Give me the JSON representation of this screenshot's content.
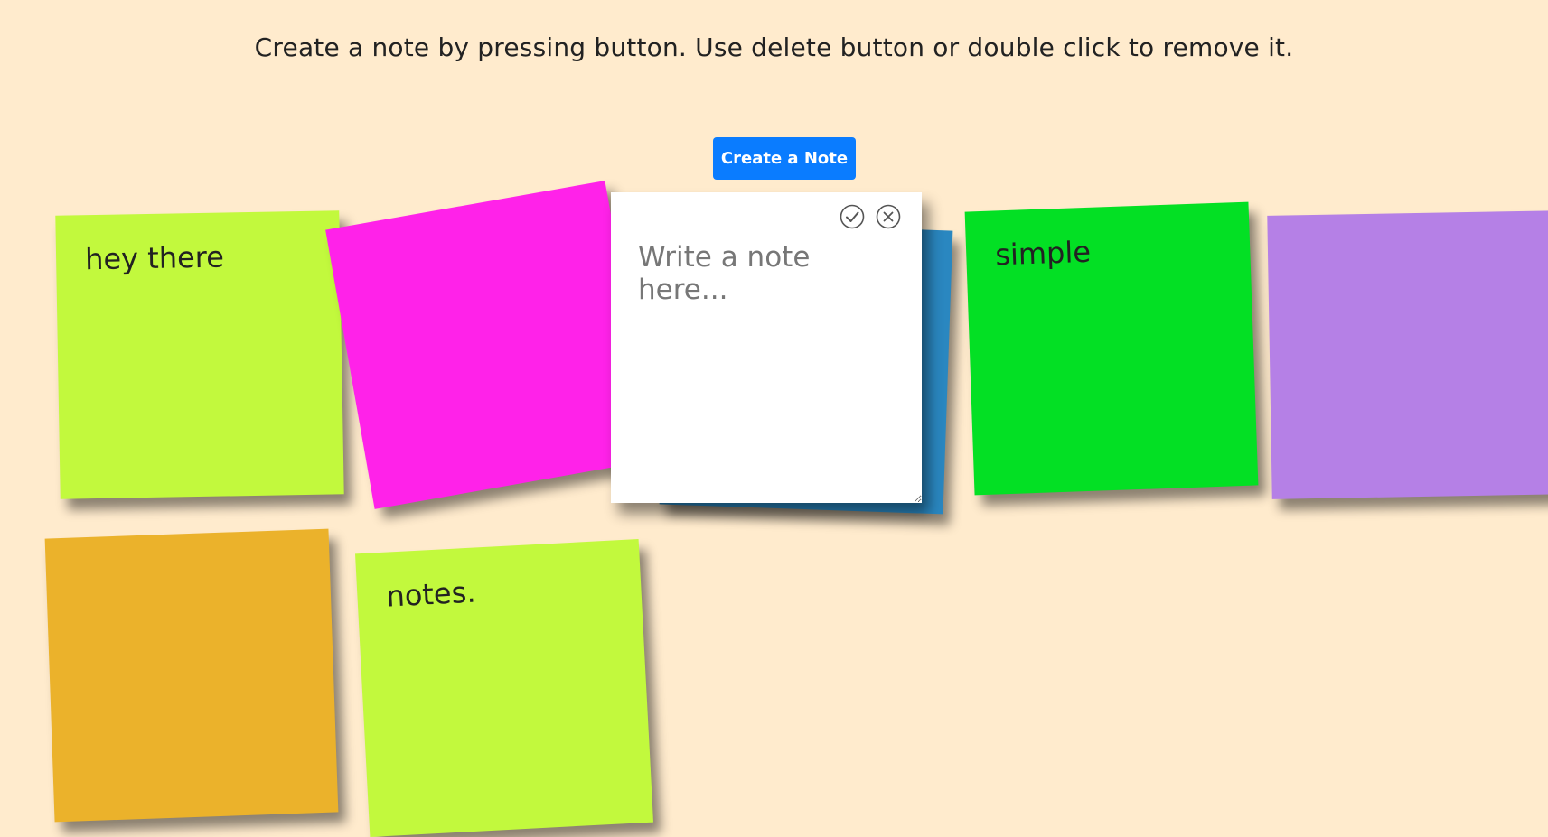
{
  "instructions": "Create a note by pressing button. Use delete button or double click to remove it.",
  "create_button": {
    "label": "Create a Note",
    "color": "#0a7cff"
  },
  "editor": {
    "placeholder": "Write a note here...",
    "value": "",
    "icons": [
      "confirm-icon",
      "cancel-icon"
    ]
  },
  "notes": [
    {
      "text": "hey there",
      "color": "#c2f93d"
    },
    {
      "text": "",
      "color": "#ff22e9"
    },
    {
      "text": "",
      "color": "#2a87c0"
    },
    {
      "text": "simple",
      "color": "#03e024"
    },
    {
      "text": "",
      "color": "#b580e6"
    },
    {
      "text": "",
      "color": "#ebb22b"
    },
    {
      "text": "notes.",
      "color": "#c2f93d"
    }
  ]
}
